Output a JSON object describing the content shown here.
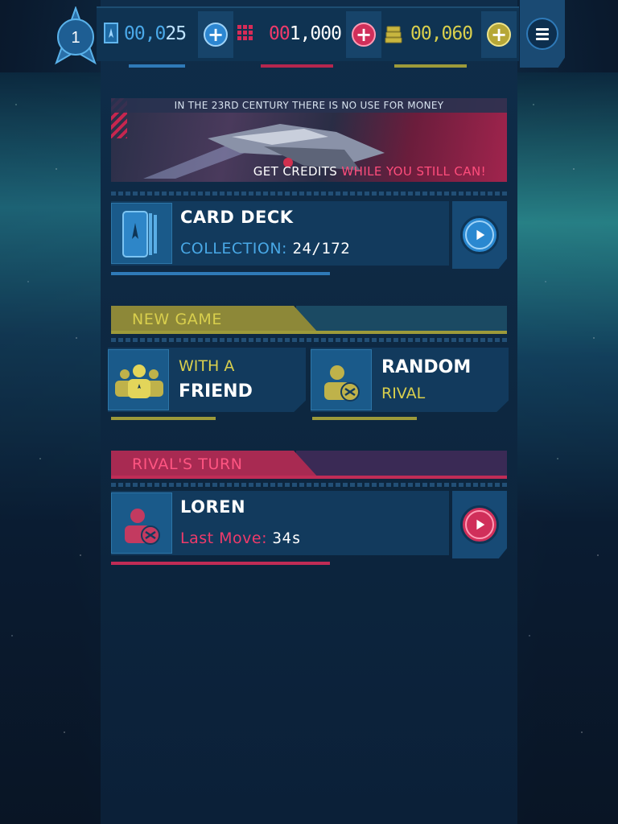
{
  "player": {
    "rank": "1"
  },
  "currencies": [
    {
      "name": "cards",
      "value": "00,025",
      "dim_prefix": "00,0",
      "bright_suffix": "25",
      "color": "#4aa8e8",
      "icon": "card-pack-icon"
    },
    {
      "name": "credits",
      "value": "001,000",
      "dim_prefix": "00",
      "bright_suffix": "1,000",
      "color": "#ef3a6a",
      "icon": "credit-chips-icon"
    },
    {
      "name": "latinum",
      "value": "00,060",
      "dim_prefix": "00,060",
      "bright_suffix": "",
      "color": "#d9cf4d",
      "icon": "latinum-bars-icon"
    }
  ],
  "banner": {
    "top_text": "IN THE 23RD CENTURY THERE IS NO USE FOR MONEY",
    "bottom_text_a": "GET CREDITS ",
    "bottom_text_b": "WHILE YOU STILL CAN!"
  },
  "card_deck": {
    "title": "CARD DECK",
    "collection_label": "COLLECTION:",
    "collection_value": "24/172"
  },
  "new_game": {
    "header": "NEW GAME",
    "friend": {
      "line1": "WITH A",
      "line2": "FRIEND"
    },
    "random": {
      "line1": "RANDOM",
      "line2": "RIVAL"
    }
  },
  "rivals_turn": {
    "header": "RIVAL'S TURN",
    "opponent_name": "LOREN",
    "last_move_label": "Last Move:",
    "last_move_value": "34s"
  },
  "colors": {
    "accent_blue": "#49a8e6",
    "accent_red": "#ef3a6a",
    "accent_yellow": "#d9cf4d",
    "panel": "#123a5d"
  }
}
